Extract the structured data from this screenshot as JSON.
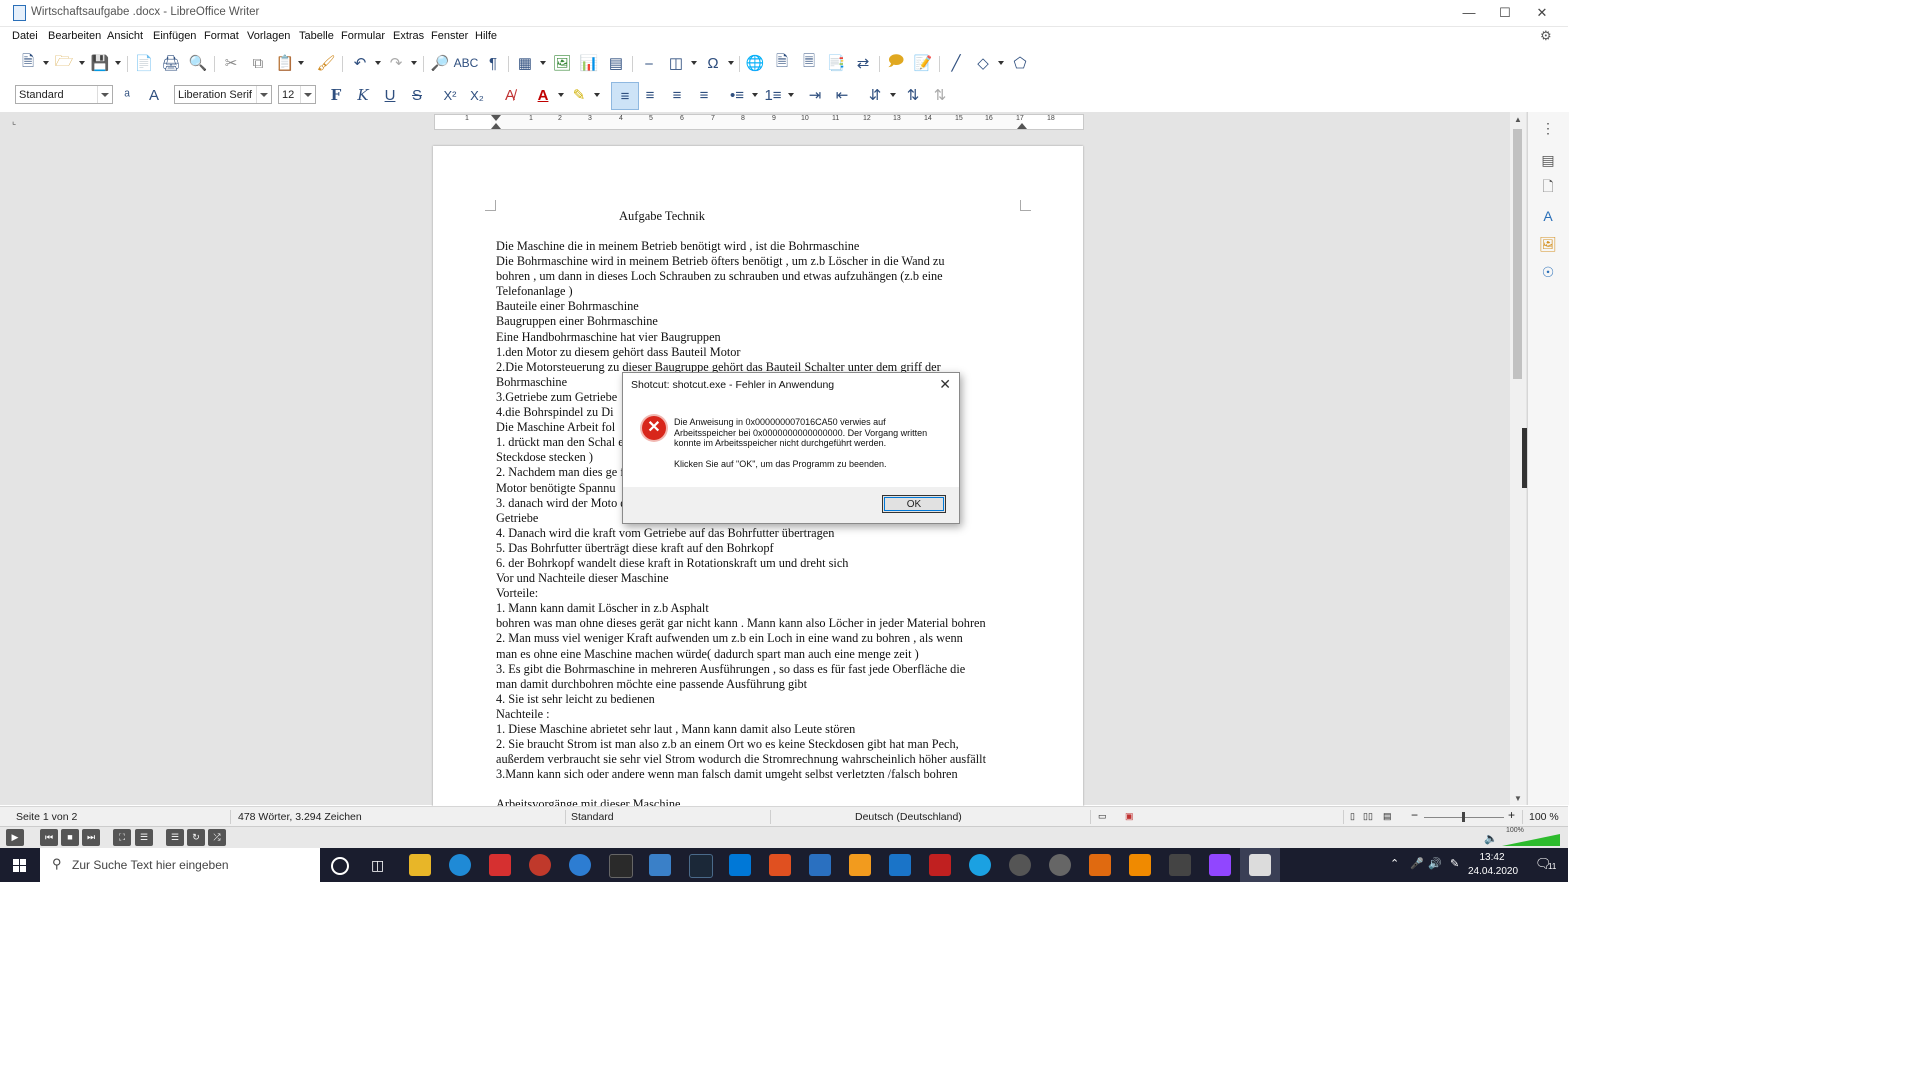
{
  "window": {
    "title": "Wirtschaftsaufgabe .docx - LibreOffice Writer"
  },
  "menu": [
    "Datei",
    "Bearbeiten",
    "Ansicht",
    "Einfügen",
    "Format",
    "Vorlagen",
    "Tabelle",
    "Formular",
    "Extras",
    "Fenster",
    "Hilfe"
  ],
  "format_bar": {
    "paragraph_style": "Standard",
    "font_name": "Liberation Serif",
    "font_size": "12"
  },
  "ruler_ticks": [
    "1",
    "1",
    "2",
    "3",
    "4",
    "5",
    "6",
    "7",
    "8",
    "9",
    "10",
    "11",
    "12",
    "13",
    "14",
    "15",
    "16",
    "17",
    "18"
  ],
  "document": {
    "title": "Aufgabe Technik",
    "lines": [
      "Die Maschine die in meinem Betrieb benötigt wird , ist die Bohrmaschine",
      "Die Bohrmaschine wird in meinem Betrieb öfters benötigt , um  z.b Löscher in die Wand zu",
      "bohren , um  dann in dieses Loch Schrauben zu schrauben und etwas aufzuhängen (z.b eine",
      "Telefonanlage )",
      "Bauteile einer Bohrmaschine",
      "Baugruppen einer Bohrmaschine",
      "Eine Handbohrmaschine hat vier Baugruppen",
      "1.den Motor zu diesem gehört dass Bauteil Motor",
      "2.Die Motorsteuerung  zu dieser Baugruppe gehört das Bauteil Schalter unter dem griff der",
      "Bohrmaschine",
      "3.Getriebe zum Getriebe",
      "4.die Bohrspindel zu Di",
      "Die Maschine Arbeit fol",
      "1. drückt man den Schal                                                                                    ecker in die",
      "Steckdose stecken )",
      "2. Nachdem man dies ge                                                                                   für den",
      "Motor benötigte Spannu",
      "3. danach wird der Moto                                                                                  dass",
      "Getriebe",
      "4. Danach wird die kraft vom Getriebe auf das Bohrfutter übertragen",
      "5. Das Bohrfutter überträgt diese kraft auf den Bohrkopf",
      "6. der Bohrkopf wandelt diese kraft in Rotationskraft um und dreht sich",
      "Vor und Nachteile dieser Maschine",
      "Vorteile:",
      "1. Mann kann damit Löscher in z.b Asphalt",
      " bohren was man ohne dieses gerät gar nicht kann . Mann kann also Löcher in jeder Material bohren",
      "2. Man muss viel weniger   Kraft  aufwenden um z.b ein Loch in eine wand zu bohren , als wenn",
      "man es ohne eine Maschine machen würde( dadurch spart man auch eine menge zeit )",
      "3. Es gibt die Bohrmaschine in mehreren Ausführungen ,  so dass es für fast jede Oberfläche   die",
      "man damit durchbohren möchte eine passende Ausführung gibt",
      "4. Sie ist sehr leicht zu bedienen",
      "Nachteile :",
      "1. Diese Maschine abrietet sehr laut , Mann kann damit also Leute stören",
      "2. Sie braucht Strom ist man also z.b an einem Ort wo es keine Steckdosen gibt hat man Pech,",
      "außerdem verbraucht sie sehr viel Strom wodurch die Stromrechnung wahrscheinlich höher ausfällt",
      "3.Mann kann  sich oder andere wenn man falsch damit umgeht selbst verletzten /falsch bohren",
      "",
      "Arbeitsvorgänge mit dieser Maschine"
    ]
  },
  "status": {
    "page": "Seite 1 von 2",
    "words": "478 Wörter, 3.294 Zeichen",
    "style": "Standard",
    "language": "Deutsch (Deutschland)",
    "zoom": "100 %"
  },
  "dialog": {
    "title": "Shotcut: shotcut.exe - Fehler in Anwendung",
    "message": "Die Anweisung in 0x000000007016CA50 verwies auf Arbeitsspeicher bei 0x0000000000000000. Der Vorgang written konnte im Arbeitsspeicher nicht durchgeführt werden.",
    "hint": "Klicken Sie auf \"OK\", um das Programm zu beenden.",
    "ok": "OK"
  },
  "player": {
    "volume": "100%"
  },
  "taskbar": {
    "search_placeholder": "Zur Suche Text hier eingeben",
    "time": "13:42",
    "date": "24.04.2020",
    "notification_count": "11",
    "app_icons": [
      "explorer",
      "edge",
      "app-red-1",
      "ccleaner",
      "thunderbird",
      "epic-games",
      "office",
      "steam",
      "store",
      "bandicam",
      "writer",
      "whatsapp",
      "edge-legacy",
      "filezilla",
      "cortana-c",
      "rocket",
      "word-w",
      "audio",
      "vlc",
      "calculator",
      "twitch",
      "shotcut"
    ]
  }
}
